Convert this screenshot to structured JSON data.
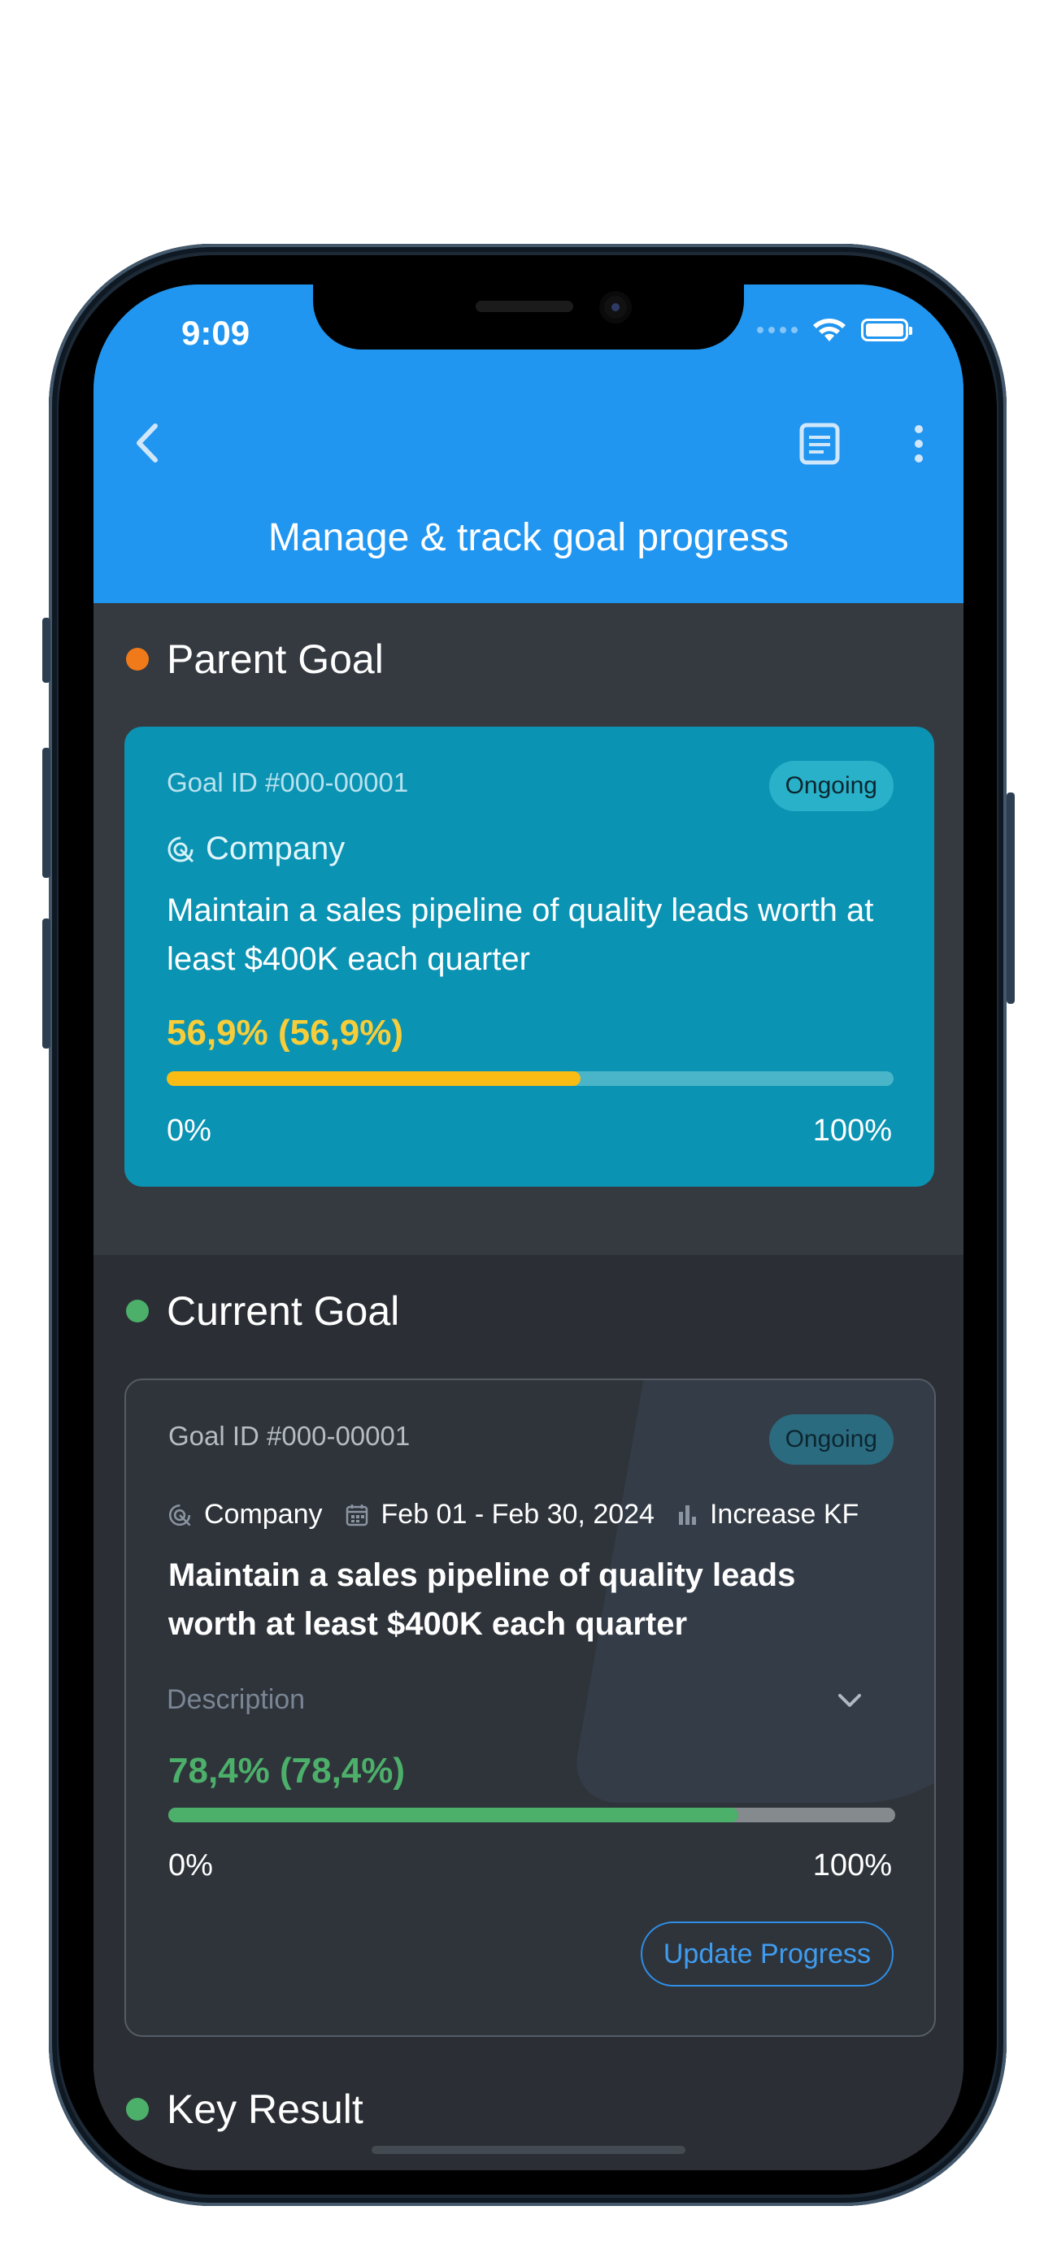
{
  "status_bar": {
    "time": "9:09"
  },
  "header": {
    "title": "Manage & track goal progress"
  },
  "colors": {
    "header_bg": "#2196f0",
    "parent_dot": "#f07a1a",
    "current_dot": "#4caf6a",
    "key_dot": "#4caf6a"
  },
  "parent_goal": {
    "heading": "Parent Goal",
    "goal_id": "Goal ID #000-00001",
    "status": "Ongoing",
    "level": "Company",
    "title": "Maintain a sales pipeline of quality leads worth at least $400K each quarter",
    "progress_label": "56,9% (56,9%)",
    "progress_value": 56.9,
    "scale_min": "0%",
    "scale_max": "100%"
  },
  "current_goal": {
    "heading": "Current Goal",
    "goal_id": "Goal ID #000-00001",
    "status": "Ongoing",
    "level": "Company",
    "date_range": "Feb 01 - Feb 30, 2024",
    "type": "Increase KF",
    "title": "Maintain a sales pipeline of quality leads worth at least $400K each quarter",
    "description_label": "Description",
    "progress_label": "78,4% (78,4%)",
    "progress_value": 78.4,
    "scale_min": "0%",
    "scale_max": "100%",
    "update_button": "Update Progress"
  },
  "key_result": {
    "heading": "Key Result"
  },
  "icons": [
    "back-chevron-icon",
    "document-icon",
    "more-vertical-icon",
    "target-icon",
    "calendar-icon",
    "bar-chart-icon",
    "chevron-down-icon",
    "wifi-icon",
    "battery-icon"
  ]
}
